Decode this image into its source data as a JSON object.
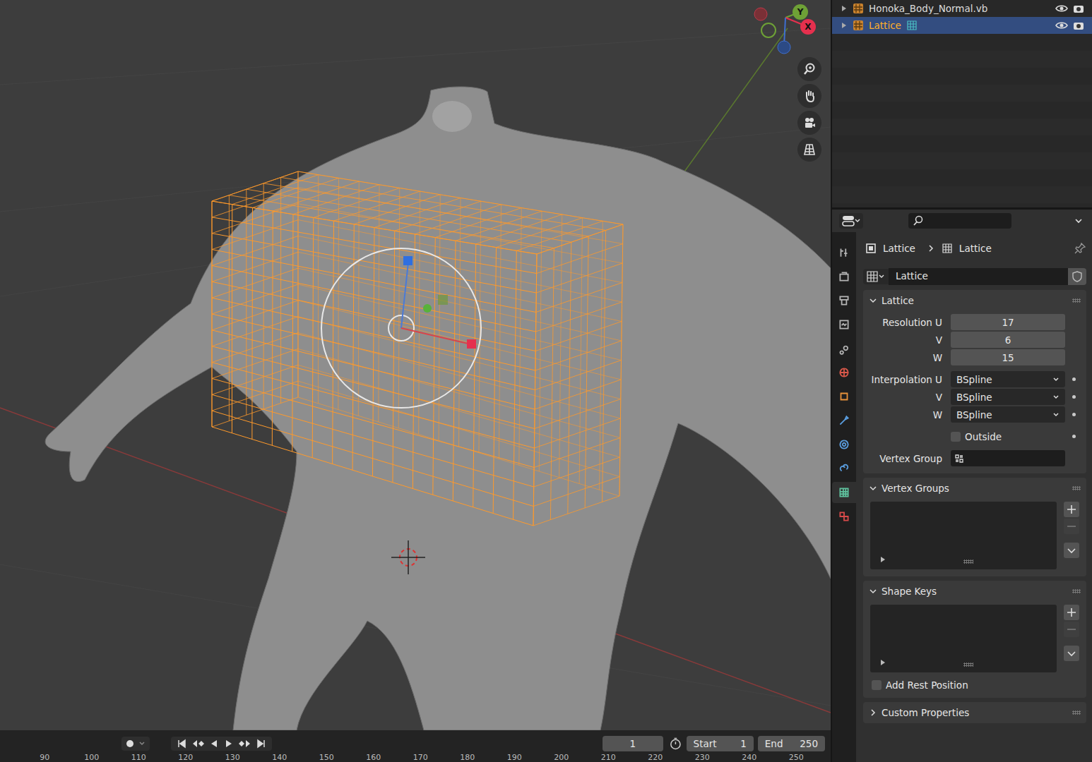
{
  "viewport": {
    "gizmo_axes": [
      {
        "label": "Y",
        "color": "#6ea136"
      },
      {
        "label": "X",
        "color": "#e5304e"
      }
    ]
  },
  "outliner": {
    "rows": [
      {
        "label": "Honoka_Body_Normal.vb",
        "selected": false
      },
      {
        "label": "Lattice",
        "selected": true
      }
    ]
  },
  "properties": {
    "tabs": [
      {
        "kind": "tool",
        "selected": false
      },
      {
        "kind": "render",
        "selected": false
      },
      {
        "kind": "output",
        "selected": false
      },
      {
        "kind": "viewlayer",
        "selected": false
      },
      {
        "kind": "scene",
        "selected": false
      },
      {
        "kind": "world",
        "selected": false
      },
      {
        "kind": "object",
        "selected": false
      },
      {
        "kind": "modifier",
        "selected": false
      },
      {
        "kind": "physics",
        "selected": false
      },
      {
        "kind": "constraint",
        "selected": false
      },
      {
        "kind": "data",
        "selected": true
      },
      {
        "kind": "texture",
        "selected": false
      }
    ],
    "breadcrumb": [
      "Lattice",
      "Lattice"
    ],
    "datablock": {
      "name": "Lattice"
    },
    "lattice_panel": {
      "title": "Lattice",
      "expanded": true,
      "resolution": [
        {
          "label": "Resolution U",
          "value": "17"
        },
        {
          "label": "V",
          "value": "6"
        },
        {
          "label": "W",
          "value": "15"
        }
      ],
      "interpolation": [
        {
          "label": "Interpolation U",
          "value": "BSpline"
        },
        {
          "label": "V",
          "value": "BSpline"
        },
        {
          "label": "W",
          "value": "BSpline"
        }
      ],
      "outside": {
        "label": "Outside",
        "checked": false
      },
      "vertex_group": {
        "label": "Vertex Group",
        "value": ""
      }
    },
    "vertex_groups_panel": {
      "title": "Vertex Groups",
      "expanded": true
    },
    "shape_keys_panel": {
      "title": "Shape Keys",
      "expanded": true,
      "add_rest_position": {
        "label": "Add Rest Position",
        "checked": false
      }
    },
    "custom_properties_panel": {
      "title": "Custom Properties",
      "expanded": false
    }
  },
  "timeline": {
    "current_frame": "1",
    "start_label": "Start",
    "start": "1",
    "end_label": "End",
    "end": "250",
    "ruler": [
      "90",
      "100",
      "110",
      "120",
      "130",
      "140",
      "150",
      "160",
      "170",
      "180",
      "190",
      "200",
      "210",
      "220",
      "230",
      "240",
      "250"
    ]
  }
}
